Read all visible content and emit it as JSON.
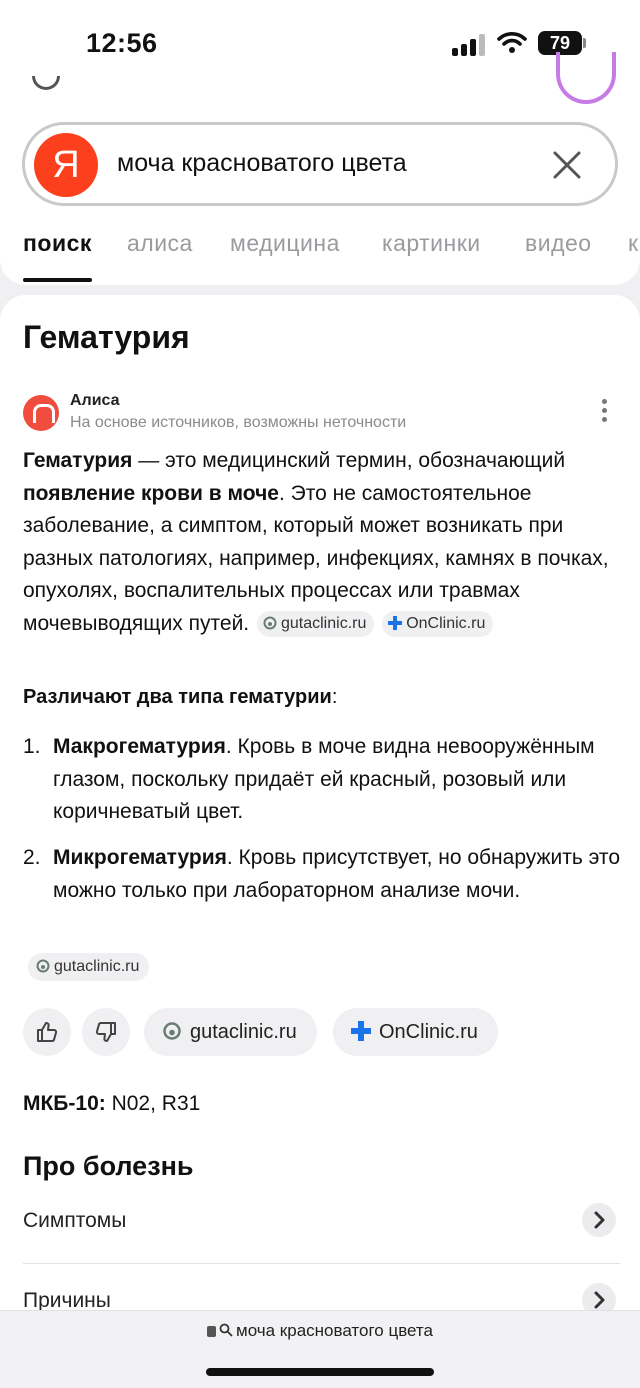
{
  "status_bar": {
    "time": "12:56",
    "battery": "79"
  },
  "search": {
    "query": "моча красноватого цвета",
    "logo_letter": "Я"
  },
  "tabs": [
    {
      "label": "поиск",
      "active": true
    },
    {
      "label": "алиса"
    },
    {
      "label": "медицина"
    },
    {
      "label": "картинки"
    },
    {
      "label": "видео"
    },
    {
      "label": "к"
    }
  ],
  "result": {
    "title": "Гематурия",
    "source_name": "Алиса",
    "source_note": "На основе источников, возможны неточности",
    "para": {
      "term": "Гематурия",
      "t1": " — это медицинский термин, обозначающий ",
      "bold": "появление крови в моче",
      "t2": ". Это не самостоятельное заболевание, а симптом, который может возникать при разных патологиях, например, инфекциях, камнях в почках, опухолях, воспалительных процессах или травмах мочевыводящих путей.",
      "chip1": "gutaclinic.ru",
      "chip2": "OnClinic.ru"
    },
    "types_title": "Различают два типа гематурии",
    "types_colon": ":",
    "items": [
      {
        "num": "1.",
        "term": "Макрогематурия",
        "text": ". Кровь в моче видна невооружённым глазом, поскольку придаёт ей красный, розовый или коричневатый цвет."
      },
      {
        "num": "2.",
        "term": "Микрогематурия",
        "text": ". Кровь присутствует, но обнаружить это можно только при лабораторном анализе мочи."
      }
    ],
    "small_source": "gutaclinic.ru",
    "action_sources": [
      "gutaclinic.ru",
      "OnClinic.ru"
    ],
    "mkb_label": "МКБ-10:",
    "mkb_value": " N02, R31",
    "section_title": "Про болезнь",
    "rows": [
      "Симптомы",
      "Причины"
    ]
  },
  "browser": {
    "url": "моча красноватого цвета"
  },
  "colors": {
    "yandex_red": "#fc3f1d",
    "alisa": "#f04d3f",
    "onclinic_blue": "#1a73e8",
    "avatar_ring": "#c77be6"
  }
}
